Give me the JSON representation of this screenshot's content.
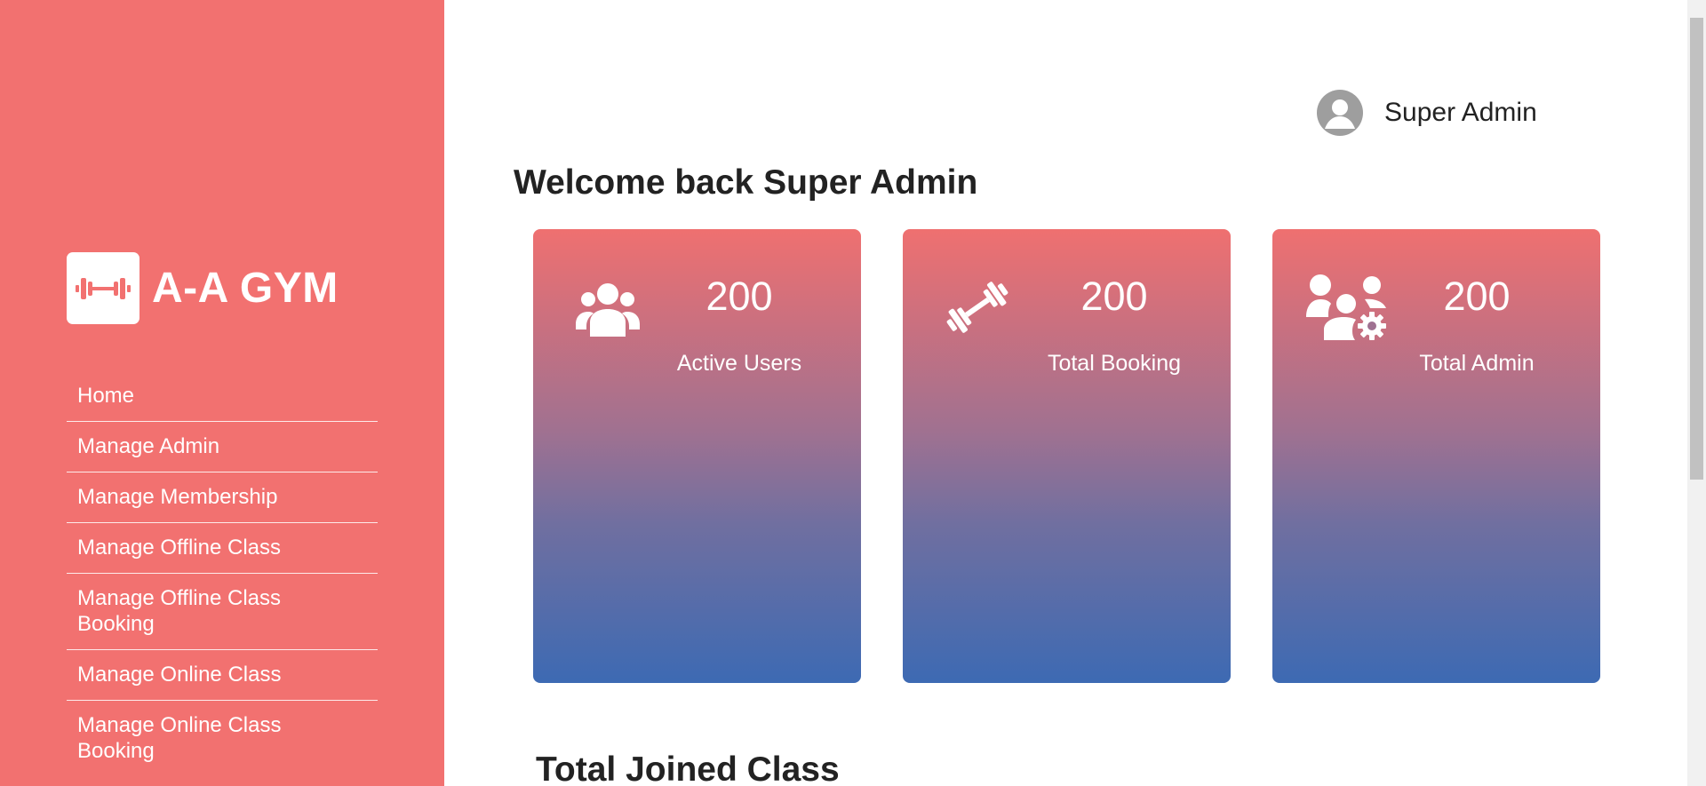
{
  "brand": {
    "name": "A-A GYM",
    "logo_icon": "dumbbell-icon"
  },
  "sidebar": {
    "items": [
      {
        "label": "Home"
      },
      {
        "label": "Manage Admin"
      },
      {
        "label": "Manage Membership"
      },
      {
        "label": "Manage Offline Class"
      },
      {
        "label": "Manage Offline Class Booking"
      },
      {
        "label": "Manage Online Class"
      },
      {
        "label": "Manage Online Class Booking"
      }
    ]
  },
  "header": {
    "user_name": "Super Admin",
    "avatar_icon": "user-circle-icon"
  },
  "main": {
    "welcome": "Welcome back Super Admin",
    "cards": [
      {
        "value": "200",
        "label": "Active Users",
        "icon": "users-group-icon"
      },
      {
        "value": "200",
        "label": "Total Booking",
        "icon": "barbell-icon"
      },
      {
        "value": "200",
        "label": "Total Admin",
        "icon": "users-gear-icon"
      }
    ],
    "section_title": "Total Joined Class"
  },
  "colors": {
    "sidebar_bg": "#f27170",
    "card_gradient_top": "#ef7070",
    "card_gradient_bottom": "#3d6ab3"
  }
}
